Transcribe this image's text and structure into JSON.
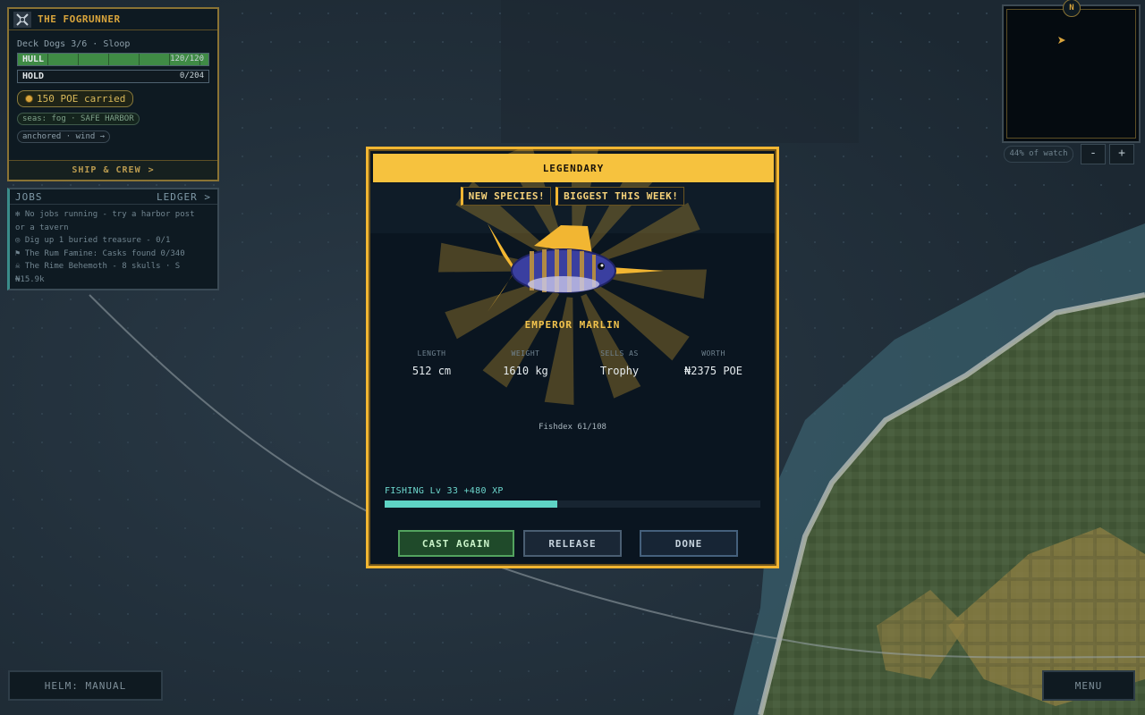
{
  "ship": {
    "name": "THE FOGRUNNER",
    "crew_line": "Deck Dogs 3/6 · Sloop",
    "hull": {
      "label": "HULL",
      "value": "120/120",
      "fraction": 1.0
    },
    "hold": {
      "label": "HOLD",
      "value": "0/204",
      "fraction": 0.0
    },
    "poe": "150 POE carried",
    "seas": "seas: fog · SAFE HARBOR",
    "wind": "anchored · wind →",
    "footer": "SHIP & CREW",
    "footer_chevron": ">"
  },
  "jobs": {
    "title": "JOBS",
    "ledger": "LEDGER",
    "ledger_chevron": ">",
    "lines": [
      "✻ No jobs running - try a harbor post",
      "or a tavern",
      "◎ Dig up 1 buried treasure - 0/1",
      "⚑ The Rum Famine: Casks found 0/340",
      "☠ The Rime Behemoth - 8 skulls · S",
      "₦15.9k"
    ]
  },
  "minimap": {
    "compass": "N",
    "zoom_label": "44% of watch",
    "zoom_out": "-",
    "zoom_in": "+"
  },
  "catch": {
    "rarity": "LEGENDARY",
    "badges": [
      "NEW SPECIES!",
      "BIGGEST THIS WEEK!"
    ],
    "species": "EMPEROR MARLIN",
    "stats": [
      {
        "label": "LENGTH",
        "value": "512 cm"
      },
      {
        "label": "WEIGHT",
        "value": "1610 kg"
      },
      {
        "label": "SELLS AS",
        "value": "Trophy"
      },
      {
        "label": "WORTH",
        "value": "₦2375 POE"
      }
    ],
    "fishdex": "Fishdex 61/108",
    "xp_label": "FISHING Lv 33  +480 XP",
    "xp_progress": 0.46,
    "buttons": {
      "cast": "CAST AGAIN",
      "release": "RELEASE",
      "done": "DONE"
    }
  },
  "helm": "HELM: MANUAL",
  "menu": "MENU",
  "colors": {
    "accent_gold": "#f2b632",
    "xp_teal": "#5ed3c4",
    "fish_body": "#3a3fa0",
    "fish_stripe": "#b08a45",
    "hull_green": "#3f8b45"
  }
}
